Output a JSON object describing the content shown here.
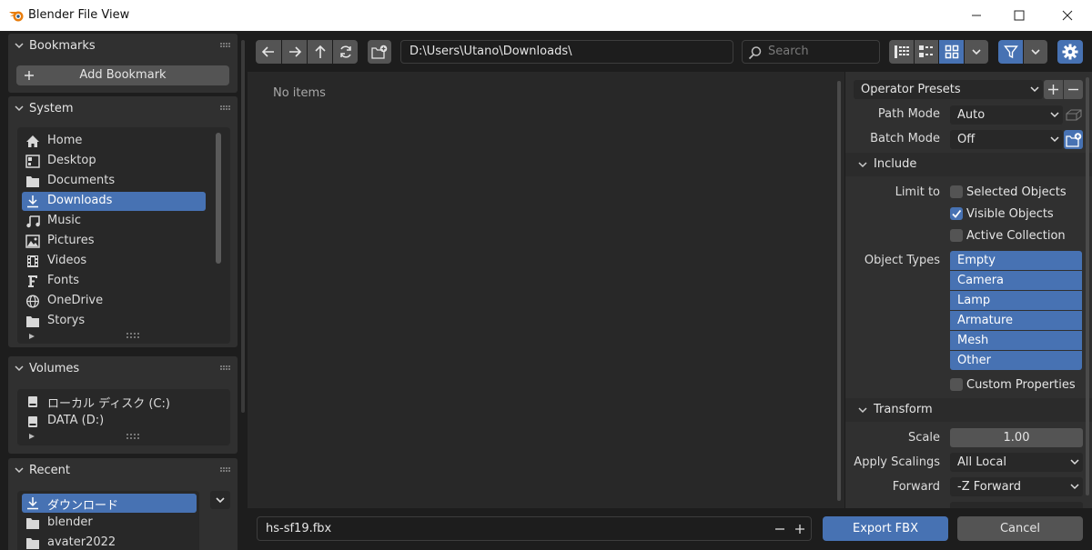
{
  "window": {
    "title": "Blender File View",
    "minimize": "—",
    "maximize": "☐",
    "close": "✕"
  },
  "sidebar": {
    "bookmarks": {
      "title": "Bookmarks",
      "add_label": "Add Bookmark"
    },
    "system": {
      "title": "System",
      "items": [
        {
          "label": "Home",
          "icon": "home-icon"
        },
        {
          "label": "Desktop",
          "icon": "desktop-icon"
        },
        {
          "label": "Documents",
          "icon": "documents-icon"
        },
        {
          "label": "Downloads",
          "icon": "download-icon",
          "selected": true
        },
        {
          "label": "Music",
          "icon": "music-icon"
        },
        {
          "label": "Pictures",
          "icon": "pictures-icon"
        },
        {
          "label": "Videos",
          "icon": "videos-icon"
        },
        {
          "label": "Fonts",
          "icon": "font-icon"
        },
        {
          "label": "OneDrive",
          "icon": "globe-icon"
        },
        {
          "label": "Storys",
          "icon": "folder-icon"
        }
      ]
    },
    "volumes": {
      "title": "Volumes",
      "items": [
        {
          "label": "ローカル ディスク (C:)",
          "icon": "disk-icon"
        },
        {
          "label": "DATA (D:)",
          "icon": "disk-icon"
        }
      ]
    },
    "recent": {
      "title": "Recent",
      "items": [
        {
          "label": "ダウンロード",
          "icon": "download-icon",
          "selected": true
        },
        {
          "label": "blender",
          "icon": "folder-icon"
        },
        {
          "label": "avater2022",
          "icon": "folder-icon"
        }
      ]
    }
  },
  "toolbar": {
    "path": "D:\\Users\\Utano\\Downloads\\",
    "search_placeholder": "Search"
  },
  "main": {
    "empty_text": "No items"
  },
  "props": {
    "operator_presets": "Operator Presets",
    "path_mode": {
      "label": "Path Mode",
      "value": "Auto"
    },
    "batch_mode": {
      "label": "Batch Mode",
      "value": "Off"
    },
    "include": {
      "title": "Include",
      "limit_to_label": "Limit to",
      "selected_objects": {
        "label": "Selected Objects",
        "checked": false
      },
      "visible_objects": {
        "label": "Visible Objects",
        "checked": true
      },
      "active_collection": {
        "label": "Active Collection",
        "checked": false
      },
      "object_types_label": "Object Types",
      "object_types": [
        "Empty",
        "Camera",
        "Lamp",
        "Armature",
        "Mesh",
        "Other"
      ],
      "custom_properties": {
        "label": "Custom Properties",
        "checked": false
      }
    },
    "transform": {
      "title": "Transform",
      "scale": {
        "label": "Scale",
        "value": "1.00"
      },
      "apply_scalings": {
        "label": "Apply Scalings",
        "value": "All Local"
      },
      "forward": {
        "label": "Forward",
        "value": "-Z Forward"
      }
    }
  },
  "bottom": {
    "filename": "hs-sf19.fbx",
    "export_label": "Export FBX",
    "cancel_label": "Cancel"
  },
  "colors": {
    "accent": "#4772b3",
    "panel": "#303030",
    "background": "#1d1d1d"
  }
}
